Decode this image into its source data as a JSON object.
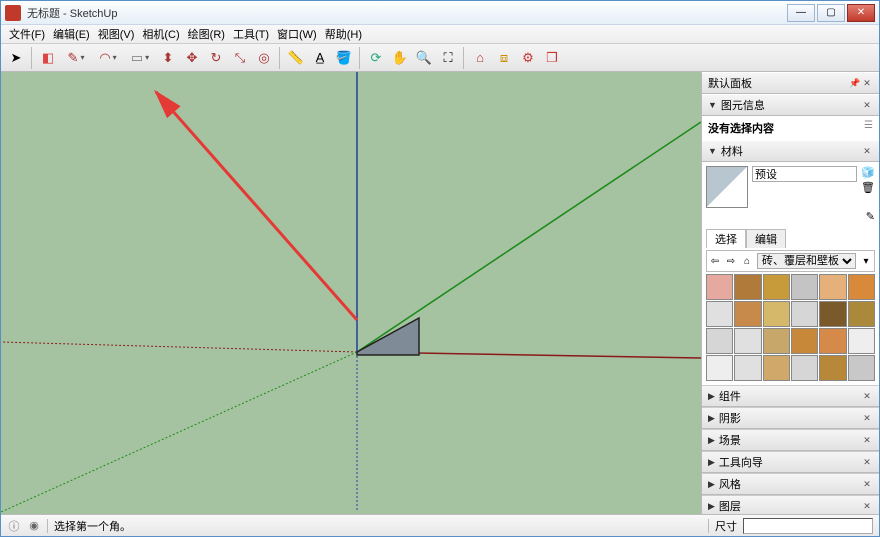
{
  "window": {
    "title": "无标题 - SketchUp"
  },
  "menus": [
    {
      "label": "文件(F)"
    },
    {
      "label": "编辑(E)"
    },
    {
      "label": "视图(V)"
    },
    {
      "label": "相机(C)"
    },
    {
      "label": "绘图(R)"
    },
    {
      "label": "工具(T)"
    },
    {
      "label": "窗口(W)"
    },
    {
      "label": "帮助(H)"
    }
  ],
  "toolbar_tips": [
    "select",
    "eraser",
    "line",
    "arc",
    "shape",
    "rect",
    "pushpull",
    "move",
    "rotate",
    "scale",
    "offset",
    "tape",
    "text",
    "dimension",
    "paint",
    "orbit",
    "pan",
    "zoom",
    "zoom-extents",
    "extension1",
    "extension2",
    "extension3",
    "extension4"
  ],
  "tray": {
    "title": "默认面板",
    "entity_info": {
      "title": "图元信息",
      "message": "没有选择内容"
    },
    "materials": {
      "title": "材料",
      "preset_value": "预设",
      "tabs": {
        "select": "选择",
        "edit": "编辑"
      },
      "category_value": "砖、覆层和壁板"
    },
    "collapsed": [
      {
        "label": "组件"
      },
      {
        "label": "阴影"
      },
      {
        "label": "场景"
      },
      {
        "label": "工具向导"
      },
      {
        "label": "风格"
      },
      {
        "label": "图层"
      }
    ]
  },
  "swatch_colors": [
    "#e6a9a0",
    "#b07a3a",
    "#c79a3a",
    "#c4c4c4",
    "#e6b07a",
    "#d88a3a",
    "#e0e0e0",
    "#c88a4a",
    "#d6b86a",
    "#d6d6d6",
    "#7a5a2a",
    "#aa8a3a",
    "#d6d6d6",
    "#e0e0e0",
    "#c8a86a",
    "#c8883a",
    "#d68a4a",
    "#eeeeee",
    "#eeeeee",
    "#e0e0e0",
    "#d0a86a",
    "#d6d6d6",
    "#b8883a",
    "#c8c8c8"
  ],
  "status": {
    "hint": "选择第一个角。",
    "dim_label": "尺寸",
    "dim_value": ""
  }
}
